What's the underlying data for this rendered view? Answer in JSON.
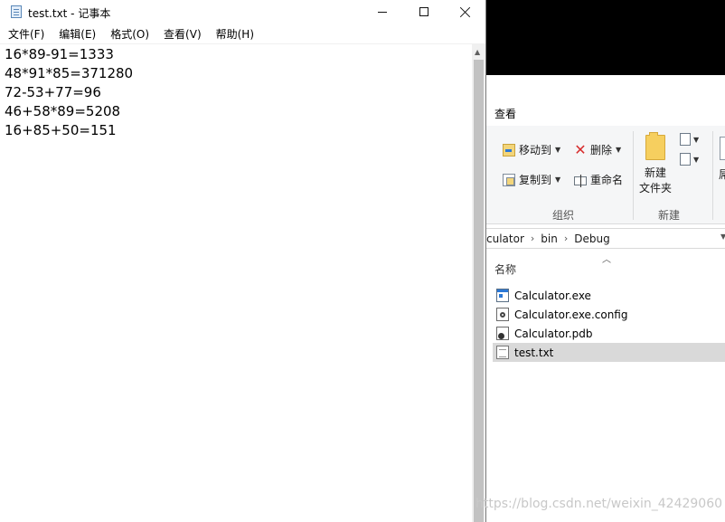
{
  "notepad": {
    "title": "test.txt - 记事本",
    "menu": [
      "文件(F)",
      "编辑(E)",
      "格式(O)",
      "查看(V)",
      "帮助(H)"
    ],
    "lines": [
      "16*89-91=1333",
      "48*91*85=371280",
      "72-53+77=96",
      "46+58*89=5208",
      "16+85+50=151"
    ],
    "icons": {
      "app": "notepad-icon",
      "minimize": "minimize-icon",
      "maximize": "maximize-icon",
      "close": "close-icon"
    }
  },
  "explorer": {
    "tab": "查看",
    "ribbon": {
      "move_to": "移动到",
      "copy_to": "复制到",
      "delete": "删除",
      "rename": "重命名",
      "new_folder": "新建\n文件夹",
      "group_organize": "组织",
      "group_new": "新建",
      "cut_off_label": "屌",
      "delete_color": "#d72d2d"
    },
    "address": {
      "parts": [
        "culator",
        "bin",
        "Debug"
      ]
    },
    "column_header": "名称",
    "files": [
      {
        "name": "Calculator.exe",
        "icon": "exe-file-icon",
        "selected": false
      },
      {
        "name": "Calculator.exe.config",
        "icon": "config-file-icon",
        "selected": false
      },
      {
        "name": "Calculator.pdb",
        "icon": "pdb-file-icon",
        "selected": false
      },
      {
        "name": "test.txt",
        "icon": "text-file-icon",
        "selected": true
      }
    ],
    "selection_color": "#d9d9d9"
  },
  "watermark": "https://blog.csdn.net/weixin_42429060"
}
